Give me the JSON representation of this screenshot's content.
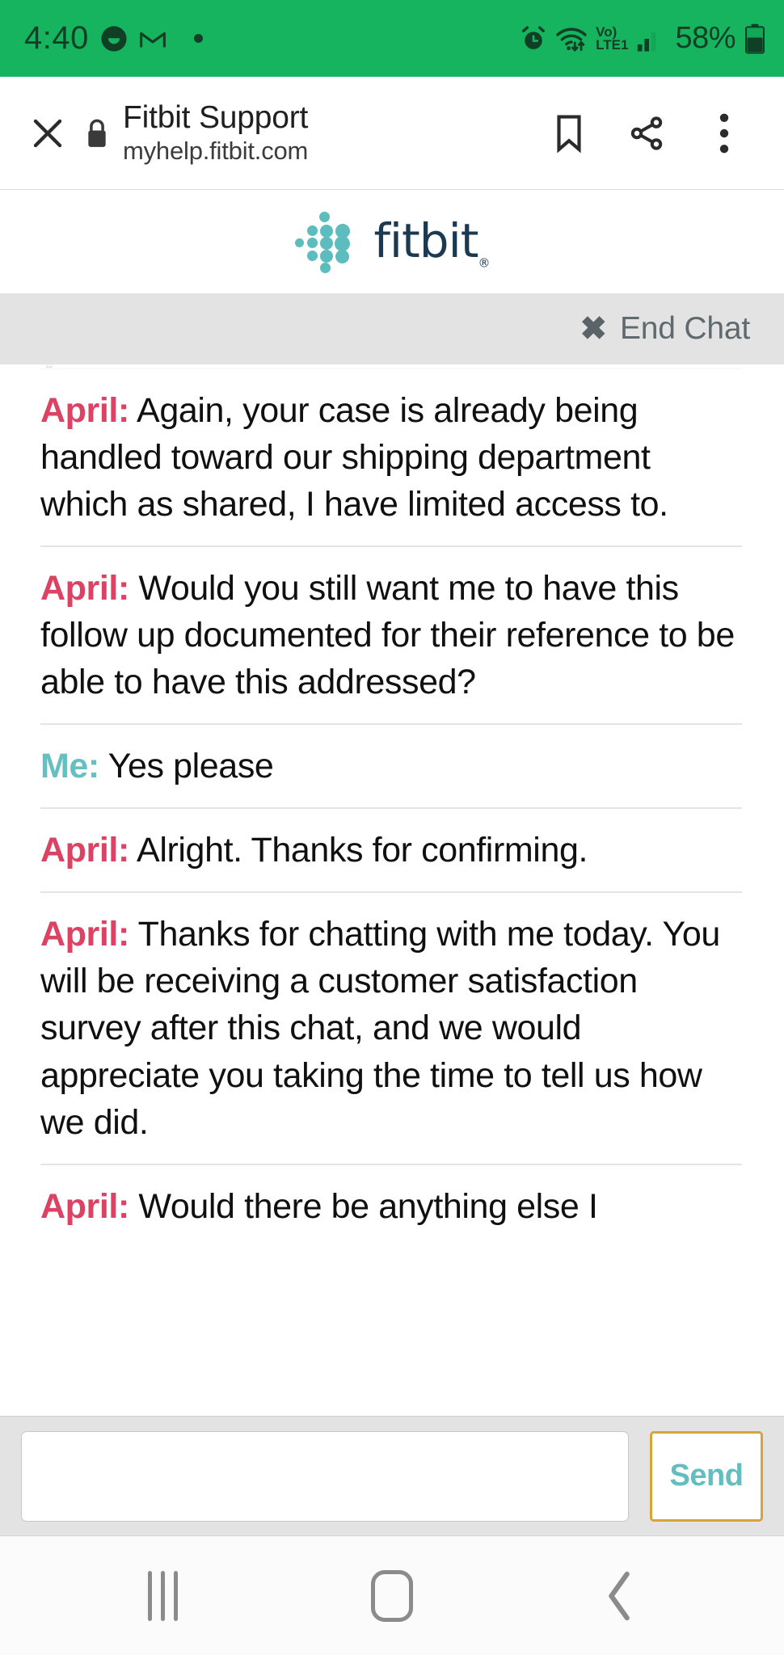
{
  "status_bar": {
    "time": "4:40",
    "battery_percent": "58%",
    "network_type": "LTE1",
    "volte_label": "Vo)",
    "icons": [
      "messenger-icon",
      "gmail-icon",
      "notification-dot-icon",
      "alarm-icon",
      "wifi-icon",
      "volte-icon",
      "signal-icon",
      "battery-icon"
    ],
    "bg_color": "#16b45e",
    "fg_color": "#0f3f25"
  },
  "browser_bar": {
    "title": "Fitbit Support",
    "url": "myhelp.fitbit.com",
    "close_label": "×",
    "icons": [
      "close-icon",
      "lock-icon",
      "bookmark-icon",
      "share-icon",
      "overflow-menu-icon"
    ]
  },
  "site_header": {
    "brand": "fitbit",
    "registered_mark": "®",
    "logo_dot_color": "#5cbcbe",
    "wordmark_color": "#1b3a52"
  },
  "chat_toolbar": {
    "end_chat_label": "End Chat",
    "end_chat_icon": "✖",
    "bg_color": "#e3e3e3"
  },
  "chat": {
    "partial_top_text": "y",
    "messages": [
      {
        "speaker": "April:",
        "speaker_type": "agent",
        "text": " Again, your case is already being handled toward our shipping department which as shared, I have limited access to."
      },
      {
        "speaker": "April:",
        "speaker_type": "agent",
        "text": " Would you still want me to have this follow up documented for their reference to be able to have this addressed?"
      },
      {
        "speaker": "Me:",
        "speaker_type": "user",
        "text": " Yes please"
      },
      {
        "speaker": "April:",
        "speaker_type": "agent",
        "text": " Alright. Thanks for confirming."
      },
      {
        "speaker": "April:",
        "speaker_type": "agent",
        "text": " Thanks for chatting with me today. You will be receiving a customer satisfaction survey after this chat, and we would appreciate you taking the time to tell us how we did."
      },
      {
        "speaker": "April:",
        "speaker_type": "agent",
        "text": " Would there be anything else I"
      }
    ],
    "agent_name_color": "#dc4263",
    "user_name_color": "#66bfc0"
  },
  "composer": {
    "input_value": "",
    "input_placeholder": "",
    "send_label": "Send",
    "send_border_color": "#d9a23c",
    "send_text_color": "#64bdbe"
  },
  "android_nav": {
    "recents_label": "Recents",
    "home_label": "Home",
    "back_label": "Back"
  }
}
